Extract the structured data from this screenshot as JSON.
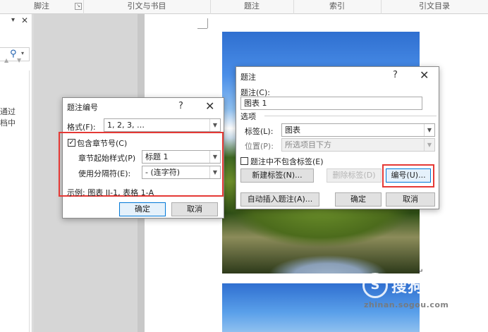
{
  "ribbon": {
    "groups": [
      {
        "label": "脚注"
      },
      {
        "label": "引文与书目"
      },
      {
        "label": "题注"
      },
      {
        "label": "索引"
      },
      {
        "label": "引文目录"
      }
    ],
    "launcher_glyph": "↘"
  },
  "nav_pane": {
    "dropdown_glyph": "▾",
    "close_glyph": "✕",
    "search_glyph": "⚲",
    "up_glyph": "▲",
    "down_glyph": "▼",
    "text_lines": [
      "通过",
      "档中"
    ]
  },
  "watermark": {
    "logo": "S",
    "text": "搜狗指南",
    "url": "zhinan.sogou.com"
  },
  "caption_dialog": {
    "title": "题注",
    "help_glyph": "?",
    "close_glyph": "✕",
    "caption_label": "题注(C):",
    "caption_value": "图表 1",
    "options_label": "选项",
    "tag_label": "标签(L):",
    "tag_value": "图表",
    "position_label": "位置(P):",
    "position_value": "所选项目下方",
    "exclude_label_text": "题注中不包含标签(E)",
    "exclude_checked": false,
    "new_label_button": "新建标签(N)...",
    "delete_label_button": "删除标签(D)",
    "numbering_button": "编号(U)...",
    "autocaption_button": "自动插入题注(A)...",
    "ok_button": "确定",
    "cancel_button": "取消"
  },
  "numbering_dialog": {
    "title": "题注编号",
    "help_glyph": "?",
    "close_glyph": "✕",
    "format_label": "格式(F):",
    "format_value": "1, 2, 3, …",
    "include_chapter_label": "包含章节号(C)",
    "include_chapter_checked": true,
    "chapter_style_label": "章节起始样式(P)",
    "chapter_style_value": "标题 1",
    "separator_label": "使用分隔符(E):",
    "separator_value": "-  (连字符)",
    "example_text": "示例: 图表 II-1, 表格 1-A",
    "ok_button": "确定",
    "cancel_button": "取消"
  },
  "accent_colors": {
    "highlight_red": "#e53935",
    "primary_blue": "#0078d7"
  }
}
